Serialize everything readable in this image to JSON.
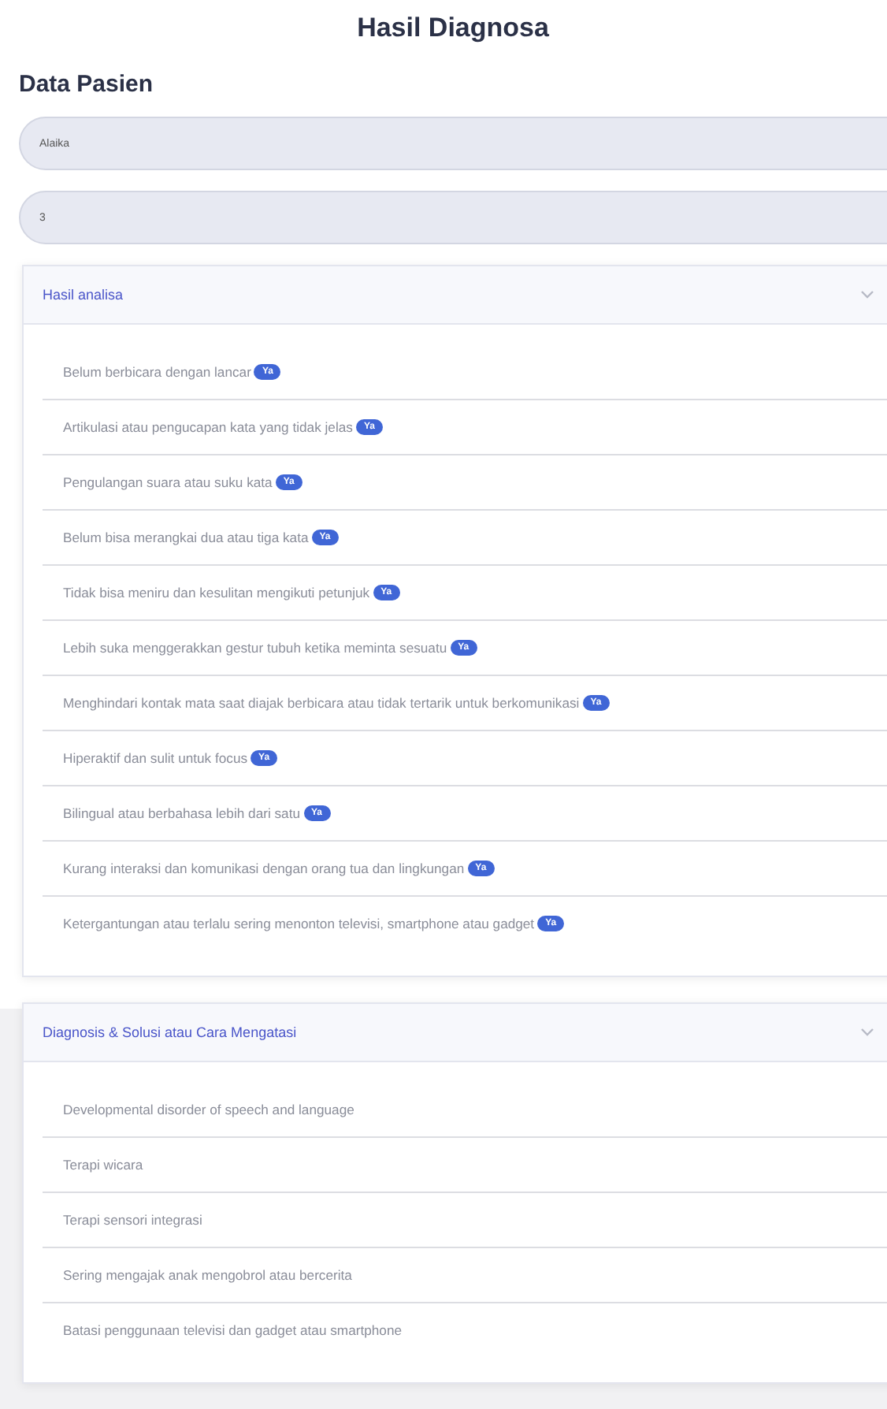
{
  "page_title": "Hasil Diagnosa",
  "section_title": "Data Pasien",
  "fields": [
    {
      "value": "Alaika"
    },
    {
      "value": "3"
    }
  ],
  "panels": [
    {
      "title": "Hasil analisa",
      "expanded": true,
      "items": [
        {
          "text": "Belum berbicara dengan lancar",
          "badge": "Ya"
        },
        {
          "text": "Artikulasi atau pengucapan kata yang tidak jelas",
          "badge": "Ya"
        },
        {
          "text": "Pengulangan suara atau suku kata",
          "badge": "Ya"
        },
        {
          "text": "Belum bisa merangkai dua atau tiga kata",
          "badge": "Ya"
        },
        {
          "text": "Tidak bisa meniru dan kesulitan mengikuti petunjuk",
          "badge": "Ya"
        },
        {
          "text": "Lebih suka menggerakkan gestur tubuh ketika meminta sesuatu",
          "badge": "Ya"
        },
        {
          "text": "Menghindari kontak mata saat diajak berbicara atau tidak tertarik untuk berkomunikasi",
          "badge": "Ya"
        },
        {
          "text": "Hiperaktif dan sulit untuk focus",
          "badge": "Ya"
        },
        {
          "text": "Bilingual atau berbahasa lebih dari satu",
          "badge": "Ya"
        },
        {
          "text": "Kurang interaksi dan komunikasi dengan orang tua dan lingkungan",
          "badge": "Ya"
        },
        {
          "text": "Ketergantungan atau terlalu sering menonton televisi, smartphone atau gadget",
          "badge": "Ya"
        }
      ]
    },
    {
      "title": "Diagnosis & Solusi atau Cara Mengatasi",
      "expanded": true,
      "items": [
        {
          "text": "Developmental disorder of speech and language"
        },
        {
          "text": "Terapi wicara"
        },
        {
          "text": "Terapi sensori integrasi"
        },
        {
          "text": "Sering mengajak anak mengobrol atau bercerita"
        },
        {
          "text": "Batasi penggunaan televisi dan gadget atau smartphone"
        }
      ]
    }
  ]
}
